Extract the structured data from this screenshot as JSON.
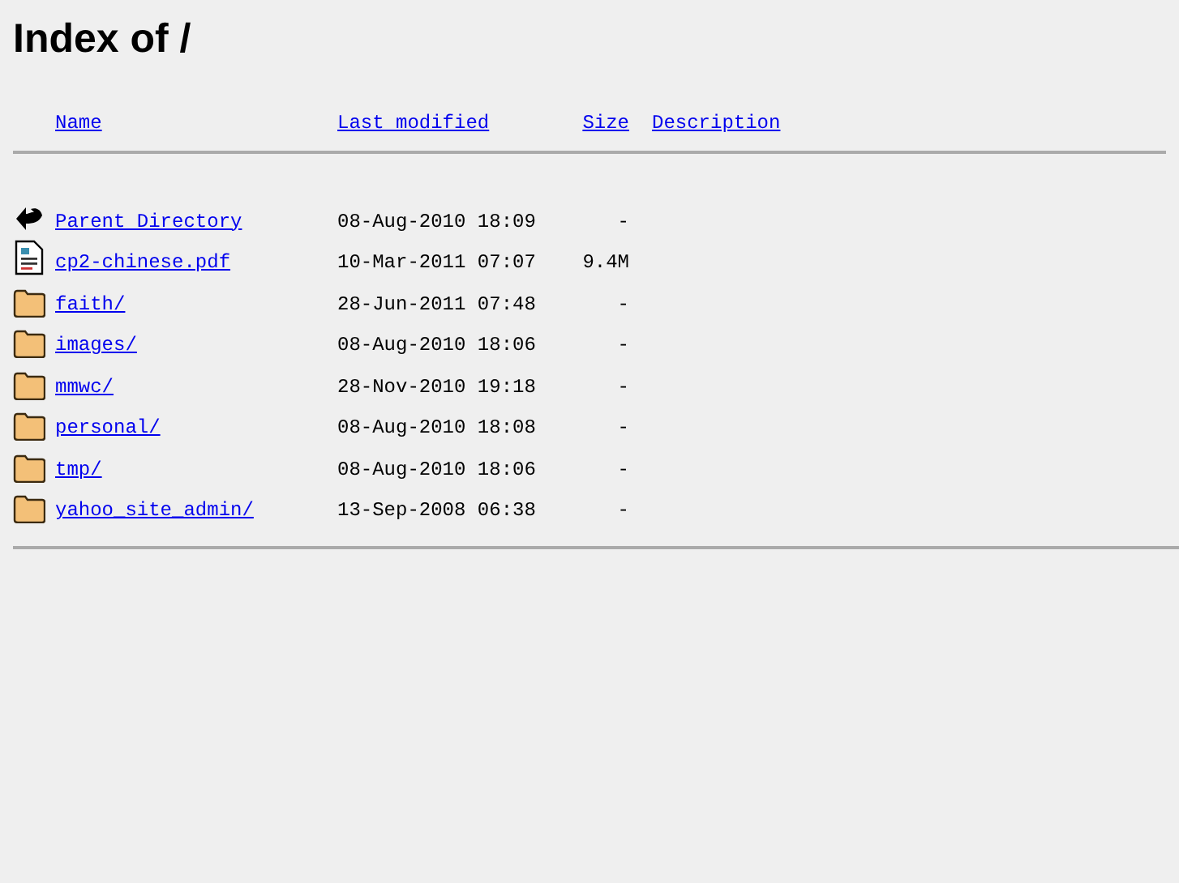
{
  "title": "Index of /",
  "columns": [
    "Name",
    "Last modified",
    "Size",
    "Description"
  ],
  "rows": [
    {
      "kind": "back",
      "name": "Parent Directory",
      "modified": "08-Aug-2010 18:09",
      "size": "-"
    },
    {
      "kind": "file",
      "name": "cp2-chinese.pdf",
      "modified": "10-Mar-2011 07:07",
      "size": "9.4M"
    },
    {
      "kind": "folder",
      "name": "faith/",
      "modified": "28-Jun-2011 07:48",
      "size": "-"
    },
    {
      "kind": "folder",
      "name": "images/",
      "modified": "08-Aug-2010 18:06",
      "size": "-"
    },
    {
      "kind": "folder",
      "name": "mmwc/",
      "modified": "28-Nov-2010 19:18",
      "size": "-"
    },
    {
      "kind": "folder",
      "name": "personal/",
      "modified": "08-Aug-2010 18:08",
      "size": "-"
    },
    {
      "kind": "folder",
      "name": "tmp/",
      "modified": "08-Aug-2010 18:06",
      "size": "-"
    },
    {
      "kind": "folder",
      "name": "yahoo_site_admin/",
      "modified": "13-Sep-2008 06:38",
      "size": "-"
    }
  ]
}
